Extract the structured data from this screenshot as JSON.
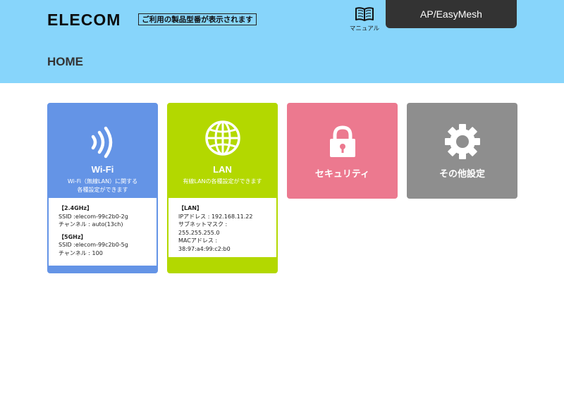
{
  "header": {
    "logo": "ELECOM",
    "model_notice": "ご利用の製品型番が表示されます",
    "manual_label": "マニュアル",
    "mode_label": "AP/EasyMesh"
  },
  "page_title": "HOME",
  "colors": {
    "header_bg": "#87d5fb",
    "mode_tab_bg": "#333333",
    "wifi": "#6494e6",
    "lan": "#b3d800",
    "security": "#ec798f",
    "other": "#8e8e8e"
  },
  "cards": {
    "wifi": {
      "icon": "wifi-signal-icon",
      "title": "Wi-Fi",
      "desc_line1": "Wi-Fi（無線LAN）に関する",
      "desc_line2": "各種設定ができます",
      "band24": {
        "heading": "【2.4GHz】",
        "ssid": "SSID :elecom-99c2b0-2g",
        "channel": "チャンネル : auto(13ch)"
      },
      "band5": {
        "heading": "【5GHz】",
        "ssid": "SSID :elecom-99c2b0-5g",
        "channel": "チャンネル : 100"
      }
    },
    "lan": {
      "icon": "globe-icon",
      "title": "LAN",
      "desc": "有線LANの各種設定ができます",
      "heading": "【LAN】",
      "ip": "IPアドレス : 192.168.11.22",
      "subnet_label": "サブネットマスク :",
      "subnet_value": "255.255.255.0",
      "mac_label": "MACアドレス :",
      "mac_value": "38:97:a4:99:c2:b0"
    },
    "security": {
      "icon": "lock-icon",
      "title": "セキュリティ"
    },
    "other": {
      "icon": "gear-icon",
      "title": "その他設定"
    }
  }
}
